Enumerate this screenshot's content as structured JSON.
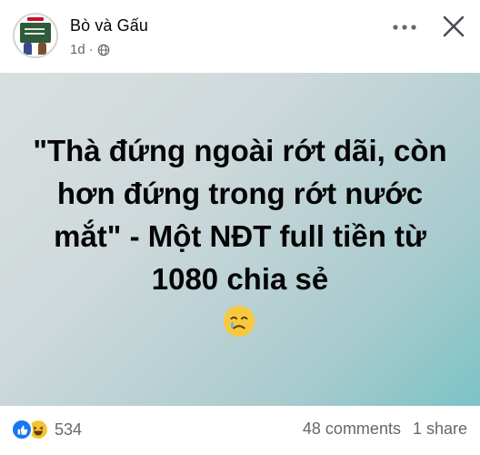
{
  "header": {
    "page_name": "Bò và Gấu",
    "time": "1d",
    "separator": "·",
    "icons": [
      "globe-icon",
      "more-icon",
      "close-icon"
    ]
  },
  "post": {
    "text": "\"Thà đứng ngoài rớt dãi, còn hơn đứng trong rớt nước mắt\" - Một NĐT full tiền từ 1080 chia sẻ",
    "emoji": "face-holding-back-tears",
    "background": "teal-gray gradient"
  },
  "footer": {
    "reaction_icons": [
      "like-icon",
      "haha-icon"
    ],
    "reaction_count": "534",
    "comments": "48 comments",
    "shares": "1 share"
  },
  "colors": {
    "like_blue": "#1877f2",
    "meta_gray": "#65676b",
    "text": "#050505"
  }
}
